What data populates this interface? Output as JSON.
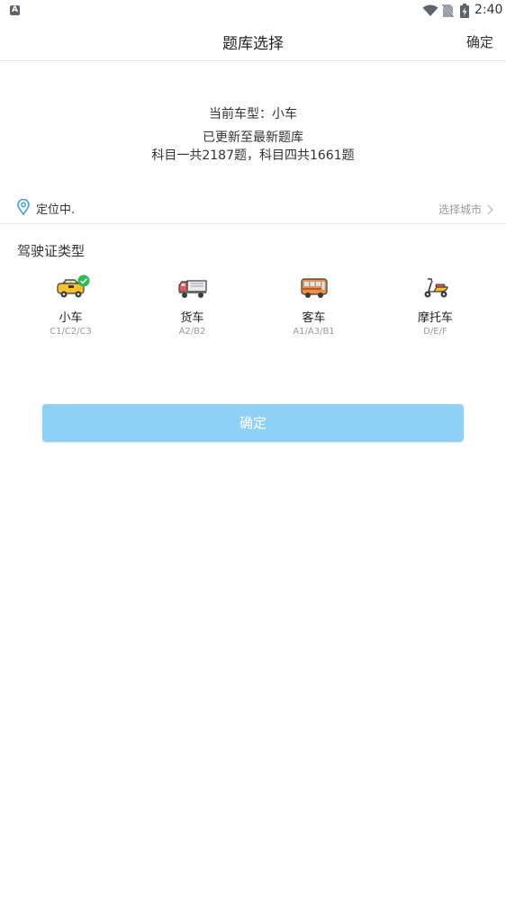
{
  "status_bar": {
    "app_letter": "A",
    "time": "2:40",
    "icons": [
      "notification-a-icon",
      "wifi-icon",
      "no-sim-icon",
      "battery-charging-icon"
    ]
  },
  "toolbar": {
    "title": "题库选择",
    "confirm_label": "确定"
  },
  "info": {
    "current_vehicle": "当前车型：小车",
    "update_status": "已更新至最新题库",
    "question_counts": "科目一共2187题，科目四共1661题"
  },
  "location": {
    "status": "定位中.",
    "select_city_label": "选择城市",
    "icon": "location-pin-icon"
  },
  "license_section": {
    "title": "驾驶证类型",
    "vehicles": [
      {
        "label": "小车",
        "classes": "C1/C2/C3",
        "icon": "car-icon",
        "selected": true
      },
      {
        "label": "货车",
        "classes": "A2/B2",
        "icon": "truck-icon",
        "selected": false
      },
      {
        "label": "客车",
        "classes": "A1/A3/B1",
        "icon": "bus-icon",
        "selected": false
      },
      {
        "label": "摩托车",
        "classes": "D/E/F",
        "icon": "scooter-icon",
        "selected": false
      }
    ]
  },
  "confirm_button": {
    "label": "确定"
  },
  "colors": {
    "button": "#8fd0f7",
    "check": "#2bbd4f",
    "location_pin": "#3aa0e8"
  }
}
